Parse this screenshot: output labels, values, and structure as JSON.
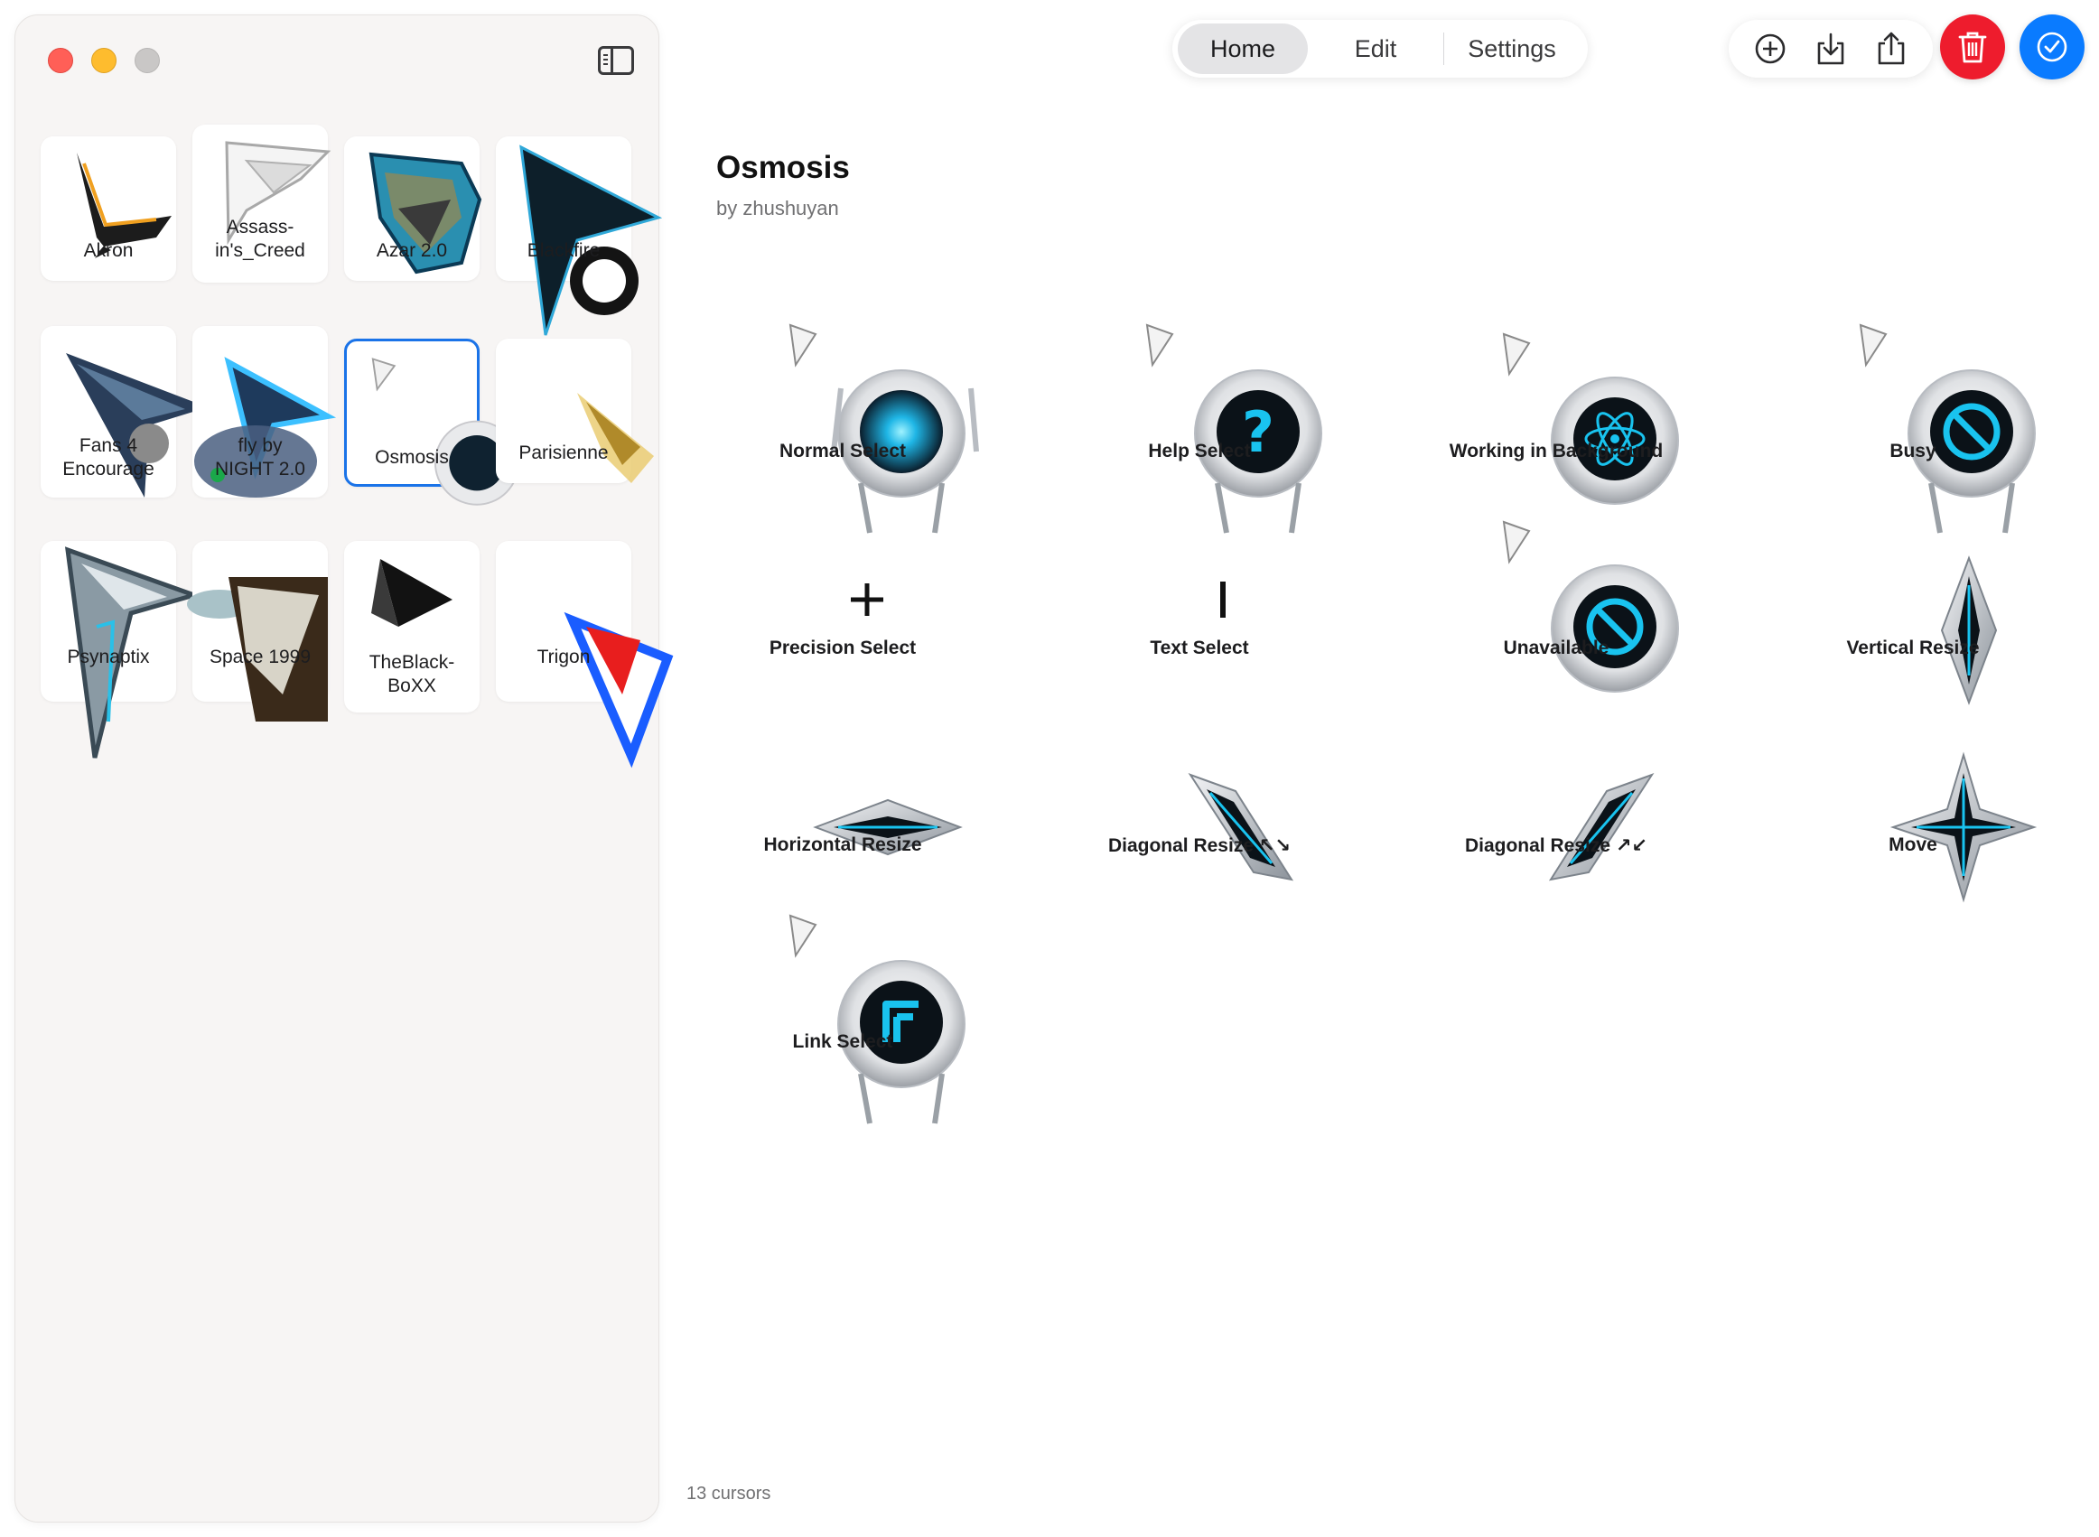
{
  "window": {
    "controls": [
      "close",
      "minimize",
      "maximize"
    ]
  },
  "toolbar": {
    "tabs": [
      {
        "label": "Home",
        "active": true
      },
      {
        "label": "Edit",
        "active": false
      },
      {
        "label": "Settings",
        "active": false
      }
    ],
    "actions": [
      "plus-circle-icon",
      "download-icon",
      "share-icon"
    ],
    "trash_color": "#ee1c2d",
    "confirm_color": "#0a7bff"
  },
  "sidebar": {
    "themes": [
      {
        "label": "Akron"
      },
      {
        "label": "Assass-\nin's_Creed"
      },
      {
        "label": "Azar 2.0"
      },
      {
        "label": "Blackfire"
      },
      {
        "label": "Fans 4\nEncourage"
      },
      {
        "label": "fly by\nNIGHT 2.0"
      },
      {
        "label": "Osmosis",
        "selected": true
      },
      {
        "label": "Parisienne"
      },
      {
        "label": "Psynaptix"
      },
      {
        "label": "Space 1999"
      },
      {
        "label": "TheBlack-\nBoXX"
      },
      {
        "label": "Trigon"
      }
    ]
  },
  "main": {
    "title": "Osmosis",
    "author": "by zhushuyan",
    "cursors": [
      {
        "label": "Normal Select",
        "icon": "glow-orb-icon"
      },
      {
        "label": "Help Select",
        "icon": "question-orb-icon"
      },
      {
        "label": "Working in Background",
        "icon": "atom-orb-icon"
      },
      {
        "label": "Busy",
        "icon": "no-orb-icon"
      },
      {
        "label": "Precision Select",
        "icon": "crosshair-icon"
      },
      {
        "label": "Text Select",
        "icon": "ibeam-icon"
      },
      {
        "label": "Unavailable",
        "icon": "no-orb-icon"
      },
      {
        "label": "Vertical Resize",
        "icon": "vertical-diamond-icon"
      },
      {
        "label": "Horizontal Resize",
        "icon": "horizontal-diamond-icon"
      },
      {
        "label": "Diagonal Resize ↖↘",
        "icon": "diagonal-diamond-icon"
      },
      {
        "label": "Diagonal Resize ↗↙",
        "icon": "diagonal-diamond-icon"
      },
      {
        "label": "Move",
        "icon": "four-way-diamond-icon"
      },
      {
        "label": "Link Select",
        "icon": "link-orb-icon"
      }
    ],
    "count_label": "13 cursors"
  },
  "colors": {
    "accent": "#1a73e8",
    "cyan": "#19c3ef",
    "sidebar_bg": "#f7f5f4"
  }
}
